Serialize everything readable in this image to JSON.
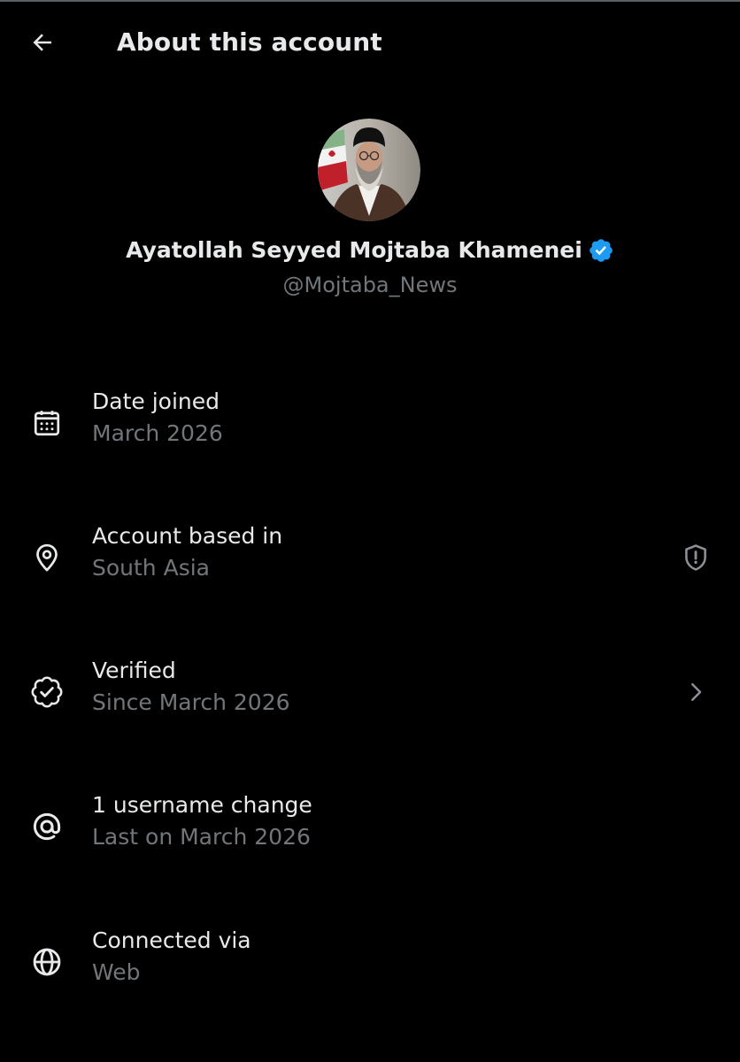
{
  "header": {
    "back_icon": "arrow-left-icon",
    "title": "About this account"
  },
  "profile": {
    "avatar_icon": "profile-photo",
    "display_name": "Ayatollah Seyyed Mojtaba Khamenei",
    "verified_icon": "verified-badge-icon",
    "handle": "@Mojtaba_News"
  },
  "rows": [
    {
      "icon": "calendar-icon",
      "title": "Date joined",
      "subtitle": "March 2026"
    },
    {
      "icon": "location-pin-icon",
      "title": "Account based in",
      "subtitle": "South Asia",
      "trailing_icon": "shield-alert-icon"
    },
    {
      "icon": "verified-outline-icon",
      "title": "Verified",
      "subtitle": "Since March 2026",
      "trailing_icon": "chevron-right-icon"
    },
    {
      "icon": "at-sign-icon",
      "title": "1 username change",
      "subtitle": "Last on March 2026"
    },
    {
      "icon": "globe-icon",
      "title": "Connected via",
      "subtitle": "Web"
    }
  ],
  "colors": {
    "background": "#000000",
    "primary_text": "#e7e9ea",
    "secondary_text": "#71767b",
    "verified_blue": "#1d9bf0"
  }
}
